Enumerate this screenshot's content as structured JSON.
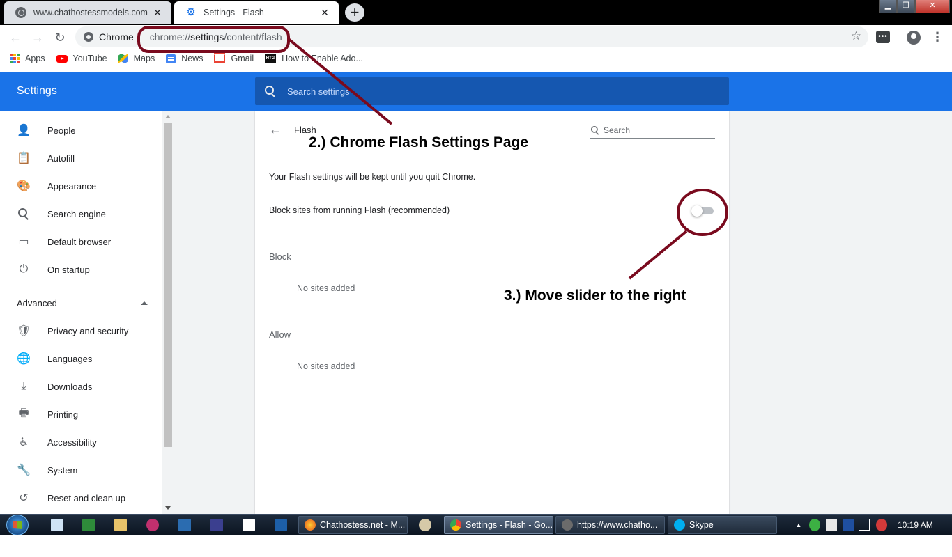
{
  "tabs": [
    {
      "title": "www.chathostessmodels.com",
      "close": "✕",
      "active": false
    },
    {
      "title": "Settings - Flash",
      "close": "✕",
      "active": true
    }
  ],
  "new_tab_label": "+",
  "toolbar": {
    "origin_chip": "Chrome",
    "url_prefix": "chrome://",
    "url_host": "settings",
    "url_path": "/content/flash"
  },
  "bookmarks": [
    {
      "label": "Apps",
      "icon": "apps-grid-icon"
    },
    {
      "label": "YouTube",
      "icon": "youtube-icon"
    },
    {
      "label": "Maps",
      "icon": "maps-icon"
    },
    {
      "label": "News",
      "icon": "news-icon"
    },
    {
      "label": "Gmail",
      "icon": "gmail-icon"
    },
    {
      "label": "How to Enable Ado...",
      "icon": "htg-icon"
    }
  ],
  "settings": {
    "title": "Settings",
    "search_placeholder": "Search settings"
  },
  "sidebar": {
    "items": [
      {
        "label": "People",
        "icon": "person-icon"
      },
      {
        "label": "Autofill",
        "icon": "clipboard-icon"
      },
      {
        "label": "Appearance",
        "icon": "palette-icon"
      },
      {
        "label": "Search engine",
        "icon": "search-icon"
      },
      {
        "label": "Default browser",
        "icon": "browser-window-icon"
      },
      {
        "label": "On startup",
        "icon": "power-icon"
      }
    ],
    "advanced_label": "Advanced",
    "advanced_items": [
      {
        "label": "Privacy and security",
        "icon": "shield-icon"
      },
      {
        "label": "Languages",
        "icon": "globe-icon"
      },
      {
        "label": "Downloads",
        "icon": "download-icon"
      },
      {
        "label": "Printing",
        "icon": "printer-icon"
      },
      {
        "label": "Accessibility",
        "icon": "accessibility-icon"
      },
      {
        "label": "System",
        "icon": "wrench-icon"
      },
      {
        "label": "Reset and clean up",
        "icon": "history-icon"
      }
    ]
  },
  "flash_page": {
    "title": "Flash",
    "search_placeholder": "Search",
    "notice": "Your Flash settings will be kept until you quit Chrome.",
    "block_toggle_label": "Block sites from running Flash (recommended)",
    "block_toggle_on": false,
    "block_heading": "Block",
    "block_empty": "No sites added",
    "allow_heading": "Allow",
    "allow_empty": "No sites added"
  },
  "annotations": {
    "step2": "2.) Chrome Flash Settings Page",
    "step3": "3.) Move slider to the right",
    "color": "#7a0a1e"
  },
  "taskbar": {
    "buttons": [
      {
        "label": "Chathostess.net - M...",
        "icon": "firefox-icon"
      },
      {
        "label": "Settings - Flash - Go...",
        "icon": "chrome-icon",
        "active": true
      },
      {
        "label": "https://www.chatho...",
        "icon": "browser-icon"
      },
      {
        "label": "Skype",
        "icon": "skype-icon"
      }
    ],
    "clock": "10:19 AM"
  },
  "colors": {
    "settings_blue": "#1a73e8",
    "settings_search_blue": "#1557b0"
  }
}
